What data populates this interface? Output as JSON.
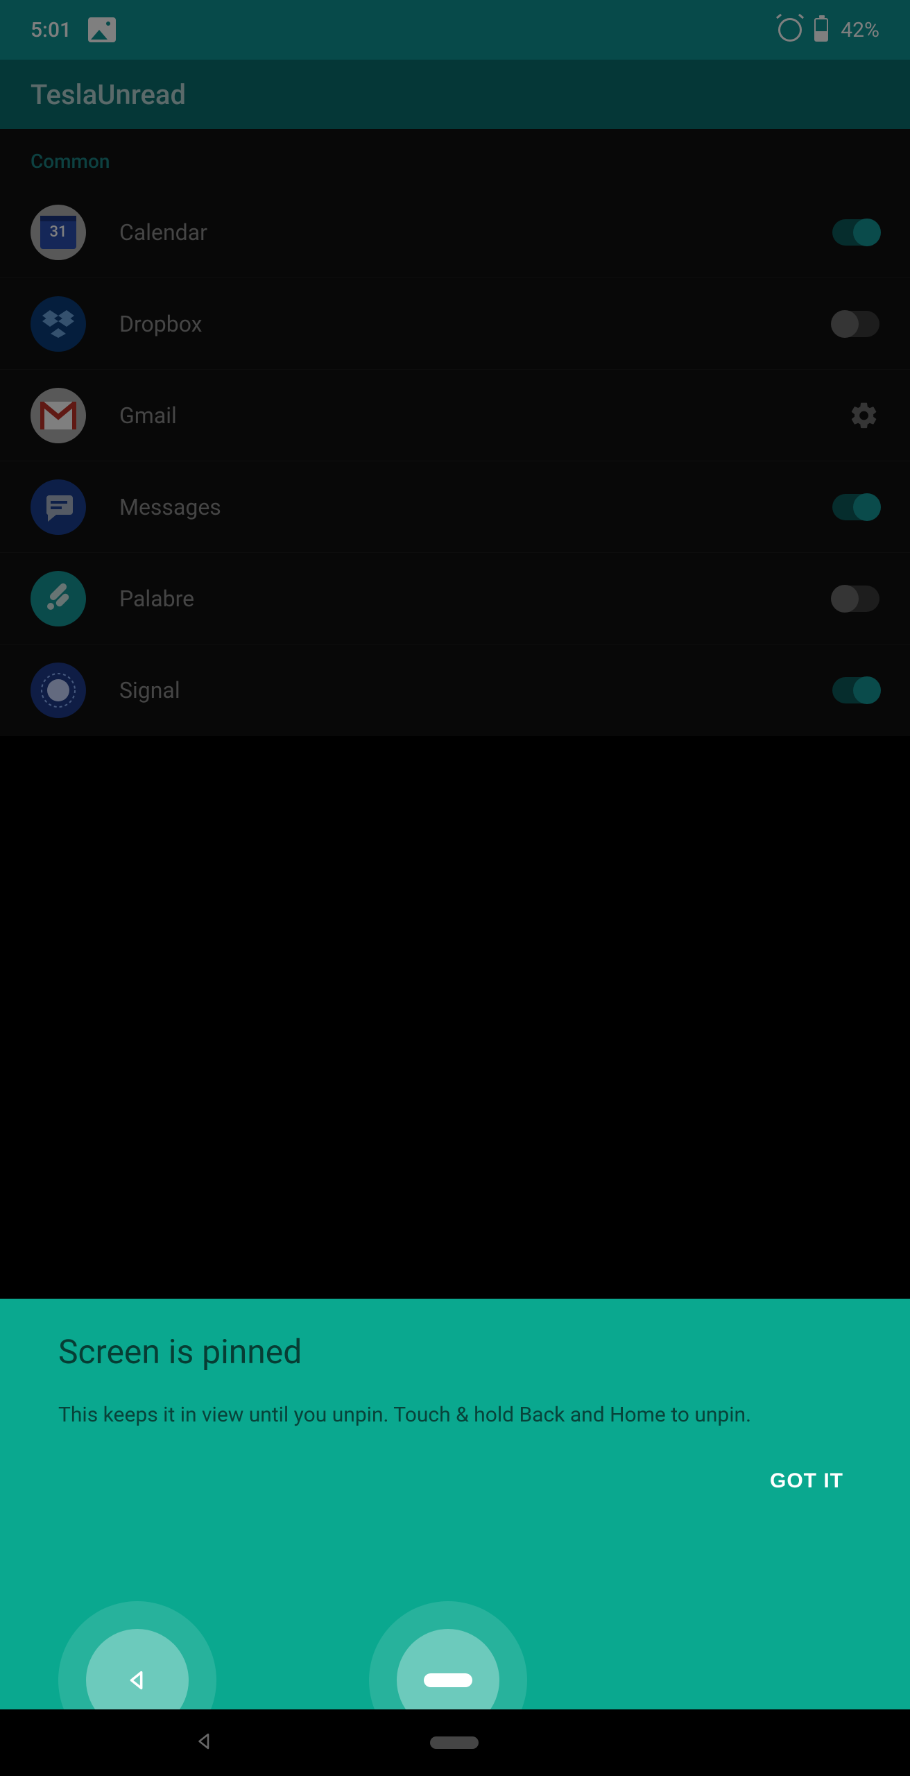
{
  "status": {
    "time": "5:01",
    "battery_percent": "42%"
  },
  "app_bar": {
    "title": "TeslaUnread"
  },
  "section_header": "Common",
  "apps": [
    {
      "name": "Calendar",
      "enabled": true,
      "has_settings": false,
      "icon": "calendar",
      "calendar_day": "31"
    },
    {
      "name": "Dropbox",
      "enabled": false,
      "has_settings": false,
      "icon": "dropbox"
    },
    {
      "name": "Gmail",
      "enabled": null,
      "has_settings": true,
      "icon": "gmail"
    },
    {
      "name": "Messages",
      "enabled": true,
      "has_settings": false,
      "icon": "messages"
    },
    {
      "name": "Palabre",
      "enabled": false,
      "has_settings": false,
      "icon": "palabre"
    },
    {
      "name": "Signal",
      "enabled": true,
      "has_settings": false,
      "icon": "signal"
    }
  ],
  "pin_dialog": {
    "title": "Screen is pinned",
    "body": "This keeps it in view until you unpin. Touch & hold Back and Home to unpin.",
    "action": "GOT IT"
  }
}
